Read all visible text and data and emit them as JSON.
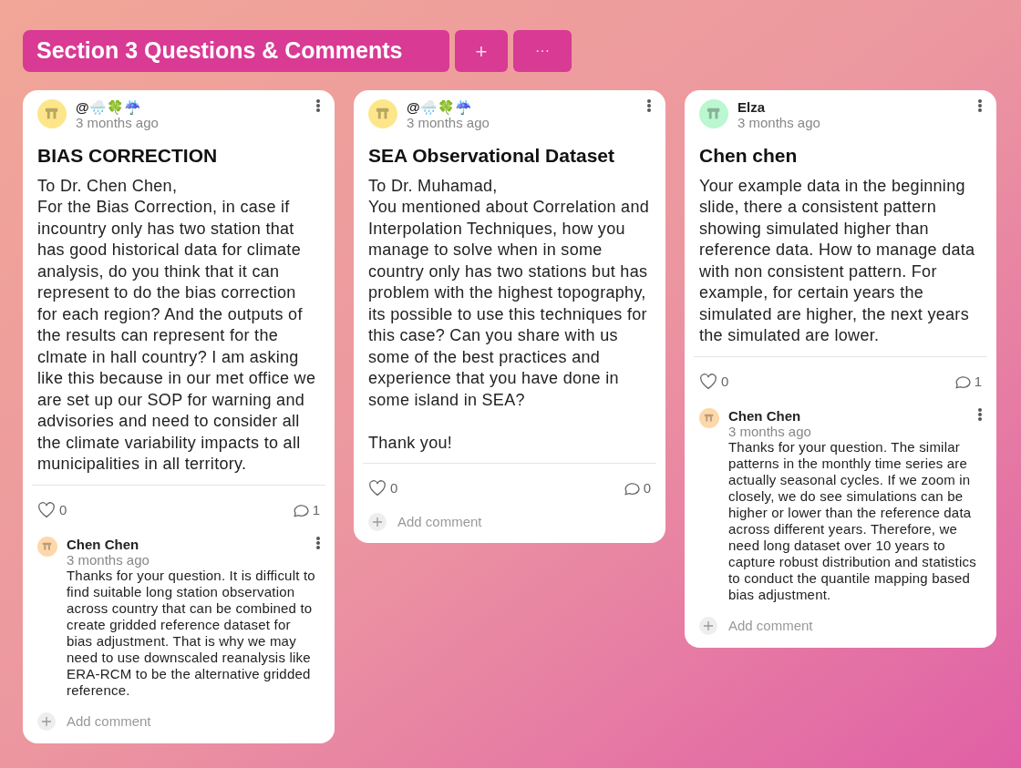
{
  "section": {
    "title": "Section 3 Questions & Comments",
    "add_label": "+",
    "more_label": "···"
  },
  "posts": [
    {
      "author": "@🌧️🍀☔",
      "color": "#fde68a",
      "time": "3 months ago",
      "title": "BIAS CORRECTION",
      "body": "To Dr. Chen Chen,\nFor the Bias Correction, in case if incountry only has two station that has good historical data for climate analysis, do you think that it can represent to do the bias correction for each region? And the outputs of the results can represent for the clmate in hall country? I am asking like this because in our met office we are set up our SOP for warning and advisories and need to consider all the climate variability impacts to all municipalities in all territory.",
      "likes": "0",
      "comment_count": "1",
      "comments": [
        {
          "author": "Chen Chen",
          "color": "#fed7aa",
          "time": "3 months ago",
          "text": "Thanks for your question. It is difficult to find suitable long station observation across country that can be combined to create gridded reference dataset for bias adjustment. That is why we may need to use downscaled reanalysis like ERA-RCM to be the alternative gridded reference."
        }
      ],
      "add_comment": "Add comment"
    },
    {
      "author": "@🌧️🍀☔",
      "color": "#fde68a",
      "time": "3 months ago",
      "title": "SEA Observational Dataset",
      "body": "To Dr. Muhamad,\nYou mentioned about Correlation and Interpolation Techniques, how you manage to solve when in some country only has two stations but has problem with the highest topography, its possible to use this techniques for this case? Can you share with us some of the best practices and experience that you have done in some island in SEA?\n\nThank you!",
      "likes": "0",
      "comment_count": "0",
      "add_comment": "Add comment"
    },
    {
      "author": "Elza",
      "color": "#bbf7d0",
      "time": "3 months ago",
      "title": "Chen chen",
      "body": "Your example data in the beginning slide, there a consistent pattern showing simulated higher than reference data. How to manage data with non consistent pattern. For example, for certain years the simulated are higher, the next years the simulated are lower.",
      "likes": "0",
      "comment_count": "1",
      "comments": [
        {
          "author": "Chen Chen",
          "color": "#fed7aa",
          "time": "3 months ago",
          "text": "Thanks for your question. The similar patterns in the monthly time series are actually seasonal cycles. If we zoom in closely, we do see simulations can be higher or lower than the reference data across different years. Therefore, we need long dataset over 10 years to capture robust distribution and statistics to conduct the quantile mapping based bias adjustment."
        }
      ],
      "add_comment": "Add comment"
    }
  ]
}
